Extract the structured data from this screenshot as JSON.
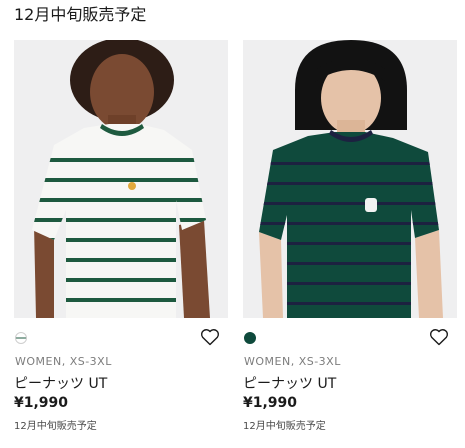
{
  "section_title": "12月中旬販売予定",
  "products": [
    {
      "swatch_color": "#ffffff",
      "swatch_stripe": "#1e5a3f",
      "category": "WOMEN, XS-3XL",
      "name": "ピーナッツ UT",
      "price": "¥1,990",
      "release_note": "12月中旬販売予定"
    },
    {
      "swatch_color": "#0f4a3c",
      "category": "WOMEN, XS-3XL",
      "name": "ピーナッツ UT",
      "price": "¥1,990",
      "release_note": "12月中旬販売予定"
    }
  ]
}
